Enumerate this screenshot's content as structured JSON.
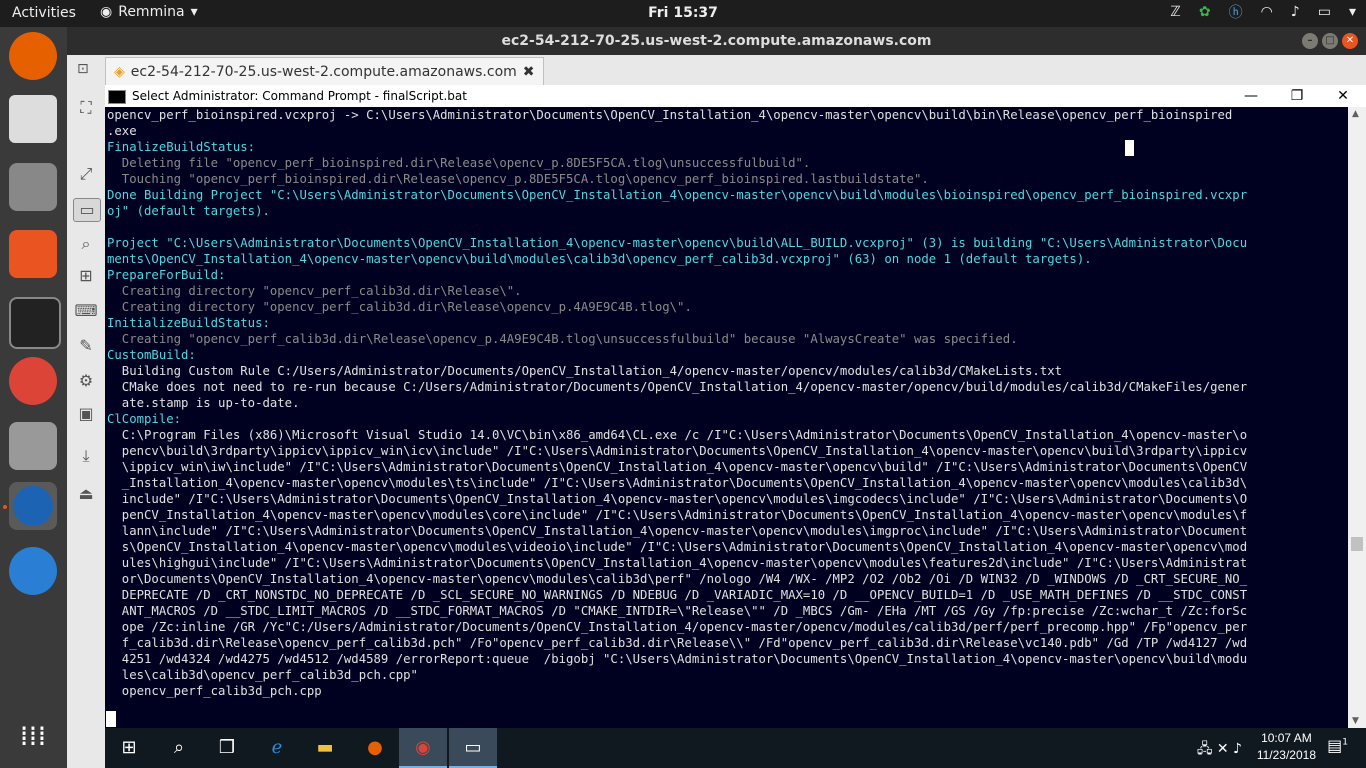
{
  "topbar": {
    "activities": "Activities",
    "app_name": "Remmina",
    "clock": "Fri 15:37"
  },
  "remmina": {
    "window_title": "ec2-54-212-70-25.us-west-2.compute.amazonaws.com",
    "tab_label": "ec2-54-212-70-25.us-west-2.compute.amazonaws.com"
  },
  "cmd": {
    "title": "Select Administrator: Command Prompt - finalScript.bat",
    "lines": [
      {
        "t": "opencv_perf_bioinspired.vcxproj -> C:\\Users\\Administrator\\Documents\\OpenCV_Installation_4\\opencv-master\\opencv\\build\\bin\\Release\\opencv_perf_bioinspired",
        "c": "c-white"
      },
      {
        "t": ".exe",
        "c": "c-white"
      },
      {
        "t": "FinalizeBuildStatus:",
        "c": "c-cyan"
      },
      {
        "t": "  Deleting file \"opencv_perf_bioinspired.dir\\Release\\opencv_p.8DE5F5CA.tlog\\unsuccessfulbuild\".",
        "c": "c-gray"
      },
      {
        "t": "  Touching \"opencv_perf_bioinspired.dir\\Release\\opencv_p.8DE5F5CA.tlog\\opencv_perf_bioinspired.lastbuildstate\".",
        "c": "c-gray"
      },
      {
        "t": "Done Building Project \"C:\\Users\\Administrator\\Documents\\OpenCV_Installation_4\\opencv-master\\opencv\\build\\modules\\bioinspired\\opencv_perf_bioinspired.vcxpr",
        "c": "c-cyan"
      },
      {
        "t": "oj\" (default targets).",
        "c": "c-cyan"
      },
      {
        "t": "",
        "c": "c-white"
      },
      {
        "t": "Project \"C:\\Users\\Administrator\\Documents\\OpenCV_Installation_4\\opencv-master\\opencv\\build\\ALL_BUILD.vcxproj\" (3) is building \"C:\\Users\\Administrator\\Docu",
        "c": "c-cyan"
      },
      {
        "t": "ments\\OpenCV_Installation_4\\opencv-master\\opencv\\build\\modules\\calib3d\\opencv_perf_calib3d.vcxproj\" (63) on node 1 (default targets).",
        "c": "c-cyan"
      },
      {
        "t": "PrepareForBuild:",
        "c": "c-cyan"
      },
      {
        "t": "  Creating directory \"opencv_perf_calib3d.dir\\Release\\\".",
        "c": "c-gray"
      },
      {
        "t": "  Creating directory \"opencv_perf_calib3d.dir\\Release\\opencv_p.4A9E9C4B.tlog\\\".",
        "c": "c-gray"
      },
      {
        "t": "InitializeBuildStatus:",
        "c": "c-cyan"
      },
      {
        "t": "  Creating \"opencv_perf_calib3d.dir\\Release\\opencv_p.4A9E9C4B.tlog\\unsuccessfulbuild\" because \"AlwaysCreate\" was specified.",
        "c": "c-gray"
      },
      {
        "t": "CustomBuild:",
        "c": "c-cyan"
      },
      {
        "t": "  Building Custom Rule C:/Users/Administrator/Documents/OpenCV_Installation_4/opencv-master/opencv/modules/calib3d/CMakeLists.txt",
        "c": "c-white"
      },
      {
        "t": "  CMake does not need to re-run because C:/Users/Administrator/Documents/OpenCV_Installation_4/opencv-master/opencv/build/modules/calib3d/CMakeFiles/gener",
        "c": "c-white"
      },
      {
        "t": "  ate.stamp is up-to-date.",
        "c": "c-white"
      },
      {
        "t": "ClCompile:",
        "c": "c-cyan"
      },
      {
        "t": "  C:\\Program Files (x86)\\Microsoft Visual Studio 14.0\\VC\\bin\\x86_amd64\\CL.exe /c /I\"C:\\Users\\Administrator\\Documents\\OpenCV_Installation_4\\opencv-master\\o",
        "c": "c-white"
      },
      {
        "t": "  pencv\\build\\3rdparty\\ippicv\\ippicv_win\\icv\\include\" /I\"C:\\Users\\Administrator\\Documents\\OpenCV_Installation_4\\opencv-master\\opencv\\build\\3rdparty\\ippicv",
        "c": "c-white"
      },
      {
        "t": "  \\ippicv_win\\iw\\include\" /I\"C:\\Users\\Administrator\\Documents\\OpenCV_Installation_4\\opencv-master\\opencv\\build\" /I\"C:\\Users\\Administrator\\Documents\\OpenCV",
        "c": "c-white"
      },
      {
        "t": "  _Installation_4\\opencv-master\\opencv\\modules\\ts\\include\" /I\"C:\\Users\\Administrator\\Documents\\OpenCV_Installation_4\\opencv-master\\opencv\\modules\\calib3d\\",
        "c": "c-white"
      },
      {
        "t": "  include\" /I\"C:\\Users\\Administrator\\Documents\\OpenCV_Installation_4\\opencv-master\\opencv\\modules\\imgcodecs\\include\" /I\"C:\\Users\\Administrator\\Documents\\O",
        "c": "c-white"
      },
      {
        "t": "  penCV_Installation_4\\opencv-master\\opencv\\modules\\core\\include\" /I\"C:\\Users\\Administrator\\Documents\\OpenCV_Installation_4\\opencv-master\\opencv\\modules\\f",
        "c": "c-white"
      },
      {
        "t": "  lann\\include\" /I\"C:\\Users\\Administrator\\Documents\\OpenCV_Installation_4\\opencv-master\\opencv\\modules\\imgproc\\include\" /I\"C:\\Users\\Administrator\\Document",
        "c": "c-white"
      },
      {
        "t": "  s\\OpenCV_Installation_4\\opencv-master\\opencv\\modules\\videoio\\include\" /I\"C:\\Users\\Administrator\\Documents\\OpenCV_Installation_4\\opencv-master\\opencv\\mod",
        "c": "c-white"
      },
      {
        "t": "  ules\\highgui\\include\" /I\"C:\\Users\\Administrator\\Documents\\OpenCV_Installation_4\\opencv-master\\opencv\\modules\\features2d\\include\" /I\"C:\\Users\\Administrat",
        "c": "c-white"
      },
      {
        "t": "  or\\Documents\\OpenCV_Installation_4\\opencv-master\\opencv\\modules\\calib3d\\perf\" /nologo /W4 /WX- /MP2 /O2 /Ob2 /Oi /D WIN32 /D _WINDOWS /D _CRT_SECURE_NO_",
        "c": "c-white"
      },
      {
        "t": "  DEPRECATE /D _CRT_NONSTDC_NO_DEPRECATE /D _SCL_SECURE_NO_WARNINGS /D NDEBUG /D _VARIADIC_MAX=10 /D __OPENCV_BUILD=1 /D _USE_MATH_DEFINES /D __STDC_CONST",
        "c": "c-white"
      },
      {
        "t": "  ANT_MACROS /D __STDC_LIMIT_MACROS /D __STDC_FORMAT_MACROS /D \"CMAKE_INTDIR=\\\"Release\\\"\" /D _MBCS /Gm- /EHa /MT /GS /Gy /fp:precise /Zc:wchar_t /Zc:forSc",
        "c": "c-white"
      },
      {
        "t": "  ope /Zc:inline /GR /Yc\"C:/Users/Administrator/Documents/OpenCV_Installation_4/opencv-master/opencv/modules/calib3d/perf/perf_precomp.hpp\" /Fp\"opencv_per",
        "c": "c-white"
      },
      {
        "t": "  f_calib3d.dir\\Release\\opencv_perf_calib3d.pch\" /Fo\"opencv_perf_calib3d.dir\\Release\\\\\" /Fd\"opencv_perf_calib3d.dir\\Release\\vc140.pdb\" /Gd /TP /wd4127 /wd",
        "c": "c-white"
      },
      {
        "t": "  4251 /wd4324 /wd4275 /wd4512 /wd4589 /errorReport:queue  /bigobj \"C:\\Users\\Administrator\\Documents\\OpenCV_Installation_4\\opencv-master\\opencv\\build\\modu",
        "c": "c-white"
      },
      {
        "t": "  les\\calib3d\\opencv_perf_calib3d_pch.cpp\"",
        "c": "c-white"
      },
      {
        "t": "  opencv_perf_calib3d_pch.cpp",
        "c": "c-white"
      }
    ]
  },
  "taskbar": {
    "time": "10:07 AM",
    "date": "11/23/2018",
    "notification_count": "1"
  },
  "colors": {
    "console_bg": "#000020",
    "cyan": "#4fd8e0",
    "ubuntu_orange": "#e95420"
  }
}
